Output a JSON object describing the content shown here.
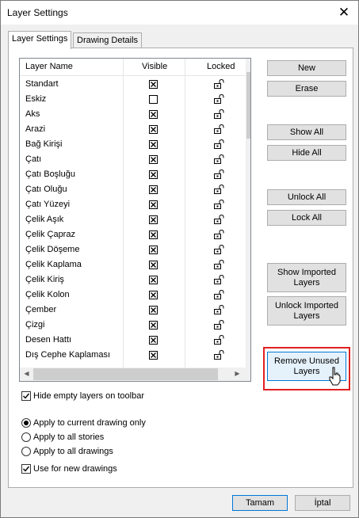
{
  "window": {
    "title": "Layer Settings",
    "close_glyph": "✕"
  },
  "tabs": [
    {
      "label": "Layer Settings",
      "active": true
    },
    {
      "label": "Drawing Details",
      "active": false
    }
  ],
  "grid": {
    "columns": [
      "Layer Name",
      "Visible",
      "Locked"
    ],
    "rows": [
      {
        "name": "Standart",
        "visible": true
      },
      {
        "name": "Eskiz",
        "visible": false
      },
      {
        "name": "Aks",
        "visible": true
      },
      {
        "name": "Arazi",
        "visible": true
      },
      {
        "name": "Bağ Kirişi",
        "visible": true
      },
      {
        "name": "Çatı",
        "visible": true
      },
      {
        "name": "Çatı Boşluğu",
        "visible": true
      },
      {
        "name": "Çatı Oluğu",
        "visible": true
      },
      {
        "name": "Çatı Yüzeyi",
        "visible": true
      },
      {
        "name": "Çelik Aşık",
        "visible": true
      },
      {
        "name": "Çelik Çapraz",
        "visible": true
      },
      {
        "name": "Çelik Döşeme",
        "visible": true
      },
      {
        "name": "Çelik Kaplama",
        "visible": true
      },
      {
        "name": "Çelik Kiriş",
        "visible": true
      },
      {
        "name": "Çelik Kolon",
        "visible": true
      },
      {
        "name": "Çember",
        "visible": true
      },
      {
        "name": "Çizgi",
        "visible": true
      },
      {
        "name": "Desen Hattı",
        "visible": true
      },
      {
        "name": "Dış Cephe Kaplaması",
        "visible": true
      }
    ],
    "locked_icon": "unlocked-padlock-icon",
    "visible_icon": "checked-box-icon"
  },
  "buttons": {
    "new": "New",
    "erase": "Erase",
    "show_all": "Show All",
    "hide_all": "Hide All",
    "unlock_all": "Unlock All",
    "lock_all": "Lock All",
    "show_imported": [
      "Show Imported",
      "Layers"
    ],
    "unlock_imported": [
      "Unlock Imported",
      "Layers"
    ],
    "remove_unused": [
      "Remove Unused",
      "Layers"
    ]
  },
  "options": {
    "hide_empty": {
      "label": "Hide empty layers on toolbar",
      "checked": true
    },
    "apply_scope": [
      {
        "label": "Apply to current drawing only",
        "selected": true
      },
      {
        "label": "Apply to all stories",
        "selected": false
      },
      {
        "label": "Apply to all drawings",
        "selected": false
      }
    ],
    "use_for_new": {
      "label": "Use for new drawings",
      "checked": true
    }
  },
  "footer": {
    "ok": "Tamam",
    "cancel": "İptal"
  },
  "colors": {
    "highlight": "#e02020",
    "accent": "#0078d7"
  }
}
